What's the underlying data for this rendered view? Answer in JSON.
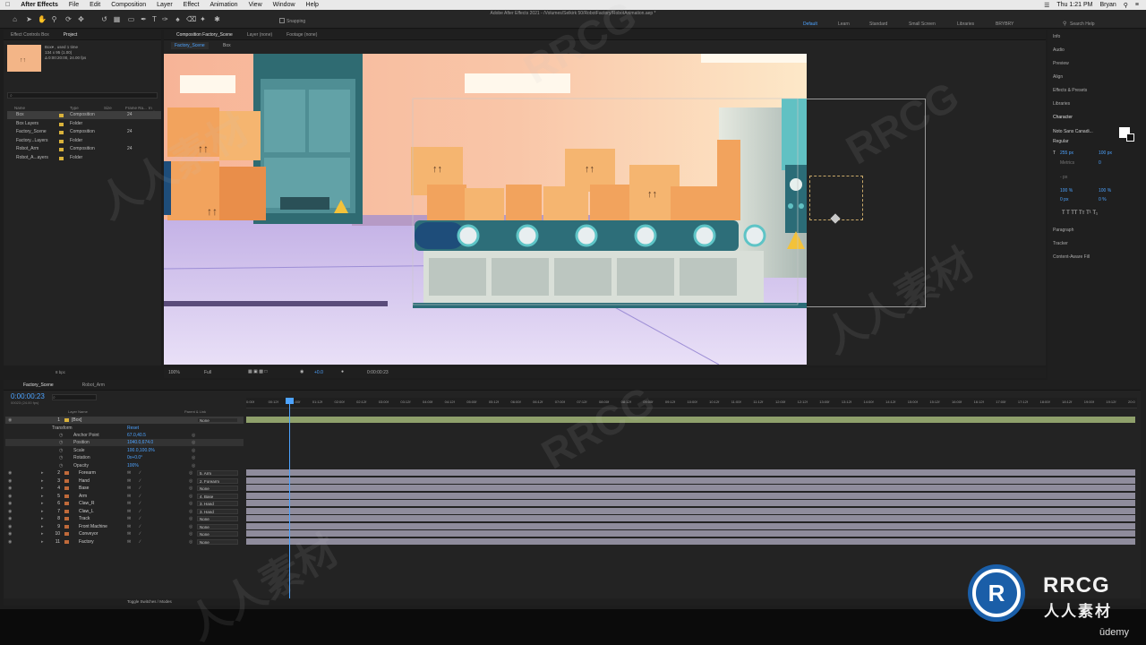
{
  "menubar": {
    "app": "After Effects",
    "items": [
      "File",
      "Edit",
      "Composition",
      "Layer",
      "Effect",
      "Animation",
      "View",
      "Window",
      "Help"
    ],
    "clock": "Thu 1:21 PM",
    "user": "Bryan"
  },
  "toolbar": {
    "snapping_label": "Snapping",
    "window_title": "Adobe After Effects 2021 - /Volumes/Selkirk 50/RobotFactory/RobotAnimation.aep *",
    "workspaces": [
      "Default",
      "Learn",
      "Standard",
      "Small Screen",
      "Libraries",
      "BRYBRY"
    ],
    "active_workspace": "Default",
    "search_help": "Search Help"
  },
  "project_panel": {
    "tabs": [
      "Effect Controls Box",
      "Project"
    ],
    "active_tab": "Project",
    "item_name": "Box▾ , used 1 time",
    "item_dims": "134 x 95 (1.00)",
    "item_duration": "Δ 0:00:20:00, 24.00 fps",
    "search_placeholder": "⌕",
    "columns": [
      "Name",
      "Type",
      "Size",
      "Frame Ra...",
      "In Point"
    ],
    "items": [
      {
        "name": "Box",
        "type": "Composition",
        "fps": "24",
        "color": "#d9b23b",
        "selected": true
      },
      {
        "name": "Box Layers",
        "type": "Folder",
        "fps": "",
        "color": "#d9b23b",
        "selected": false
      },
      {
        "name": "Factory_Scene",
        "type": "Composition",
        "fps": "24",
        "color": "#d9b23b",
        "selected": false
      },
      {
        "name": "Factory...Layers",
        "type": "Folder",
        "fps": "",
        "color": "#d9b23b",
        "selected": false
      },
      {
        "name": "Robot_Arm",
        "type": "Composition",
        "fps": "24",
        "color": "#d9b23b",
        "selected": false
      },
      {
        "name": "Robot_A...ayers",
        "type": "Folder",
        "fps": "",
        "color": "#d9b23b",
        "selected": false
      }
    ],
    "bpc": "8 bpc"
  },
  "comp_viewer": {
    "tabs": [
      "Composition Factory_Scene",
      "Layer (none)",
      "Footage (none)"
    ],
    "breadcrumbs": [
      "Factory_Scene",
      "Box"
    ],
    "zoom": "100%",
    "quality": "Full",
    "exposure": "+0.0",
    "timecode": "0:00:00:23"
  },
  "right_panels": {
    "items": [
      "Info",
      "Audio",
      "Preview",
      "Align",
      "Effects & Presets",
      "Libraries",
      "Character"
    ],
    "character": {
      "font": "Noto Sans Canadi...",
      "style": "Regular",
      "size": "255 px",
      "leading": "100 px",
      "tracking_metrics": "Metrics",
      "kerning": "0",
      "stroke": "- px",
      "vscale": "100 %",
      "hscale": "100 %",
      "baseline": "0 px",
      "tsume": "0 %"
    },
    "lower_items": [
      "Paragraph",
      "Tracker",
      "Content-Aware Fill"
    ]
  },
  "timeline": {
    "tabs": [
      "Factory_Scene",
      "Robot_Arm"
    ],
    "active_tab": "Factory_Scene",
    "timecode": "0:00:00:23",
    "timecode_sub": "00023 (24.00 fps)",
    "search_placeholder": "⌕",
    "columns": [
      "Layer Name",
      "Parent & Link"
    ],
    "ruler_ticks": [
      "0:00f",
      "00:12f",
      "01:00f",
      "01:12f",
      "02:00f",
      "02:12f",
      "03:00f",
      "03:12f",
      "04:00f",
      "04:12f",
      "05:00f",
      "05:12f",
      "06:00f",
      "06:12f",
      "07:00f",
      "07:12f",
      "08:00f",
      "08:12f",
      "09:00f",
      "09:12f",
      "10:00f",
      "10:12f",
      "11:00f",
      "11:12f",
      "12:00f",
      "12:12f",
      "13:00f",
      "13:12f",
      "14:00f",
      "14:12f",
      "15:00f",
      "15:12f",
      "16:00f",
      "16:12f",
      "17:00f",
      "17:12f",
      "18:00f",
      "18:12f",
      "19:00f",
      "19:12f",
      "20:0"
    ],
    "layer1": {
      "num": "1",
      "name": "[Box]",
      "parent": "None"
    },
    "transform": {
      "label": "Transform",
      "reset": "Reset",
      "props": [
        {
          "name": "Anchor Point",
          "value": "67.0,40.5"
        },
        {
          "name": "Position",
          "value": "1040.0,674.0"
        },
        {
          "name": "Scale",
          "value": "100.0,100.0%"
        },
        {
          "name": "Rotation",
          "value": "0x+0.0°"
        },
        {
          "name": "Opacity",
          "value": "100%"
        }
      ]
    },
    "layers": [
      {
        "num": "2",
        "name": "Forearm",
        "parent": "5. Arm"
      },
      {
        "num": "3",
        "name": "Hand",
        "parent": "2. Forearm"
      },
      {
        "num": "4",
        "name": "Base",
        "parent": "None"
      },
      {
        "num": "5",
        "name": "Arm",
        "parent": "4. Base"
      },
      {
        "num": "6",
        "name": "Claw_R",
        "parent": "3. Hand"
      },
      {
        "num": "7",
        "name": "Claw_L",
        "parent": "3. Hand"
      },
      {
        "num": "8",
        "name": "Track",
        "parent": "None"
      },
      {
        "num": "9",
        "name": "Front Machine",
        "parent": "None"
      },
      {
        "num": "10",
        "name": "Conveyor",
        "parent": "None"
      },
      {
        "num": "11",
        "name": "Factory",
        "parent": "None"
      }
    ],
    "footer": "Toggle Switches / Modes"
  },
  "branding": {
    "logo_text": "RRCG",
    "logo_sub": "人人素材",
    "udemy": "ūdemy",
    "watermark": "RRCG",
    "watermark_cn": "人人素材"
  },
  "colors": {
    "accent": "#4da3ff",
    "label_yellow": "#d9b23b",
    "bar": "#8f8c9c",
    "layer1_bar": "#8fa06b"
  }
}
